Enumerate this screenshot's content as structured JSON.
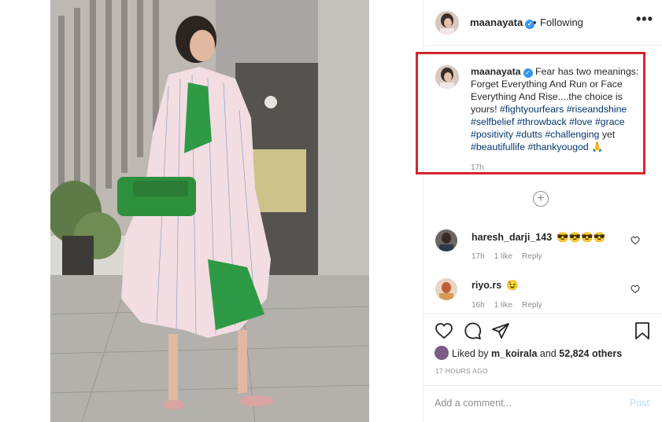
{
  "post": {
    "username": "maanayata",
    "verified_glyph": "✓",
    "dot": "•",
    "follow_status": "Following",
    "more_glyph": "•••"
  },
  "caption": {
    "username": "maanayata",
    "text_before_tags": "Fear has two meanings: Forget Everything And Run or Face Everything And Rise....the choice is yours!",
    "hashtags_1": [
      "#fightyourfears",
      "#riseandshine",
      "#selfbelief",
      "#throwback",
      "#love",
      "#grace",
      "#positivity",
      "#dutts",
      "#challenging"
    ],
    "between": "yet",
    "hashtags_2": [
      "#beautifullife",
      "#thankyougod"
    ],
    "emoji": "🙏",
    "time": "17h"
  },
  "more_comments_glyph": "+",
  "comments": [
    {
      "username": "haresh_darji_143",
      "text": "😎😎😎😎",
      "time": "17h",
      "likes": "1 like",
      "reply": "Reply"
    },
    {
      "username": "riyo.rs",
      "text": "😉",
      "time": "16h",
      "likes": "1 like",
      "reply": "Reply"
    }
  ],
  "likes": {
    "prefix": "Liked by",
    "first_liker": "m_koirala",
    "middle": "and",
    "others": "52,824 others"
  },
  "age": "17 HOURS AGO",
  "add_comment": {
    "placeholder": "Add a comment...",
    "post_label": "Post"
  },
  "colors": {
    "accent_blue": "#3897f0",
    "highlight_red": "#d3262d",
    "post_disabled": "#b3dbff"
  }
}
